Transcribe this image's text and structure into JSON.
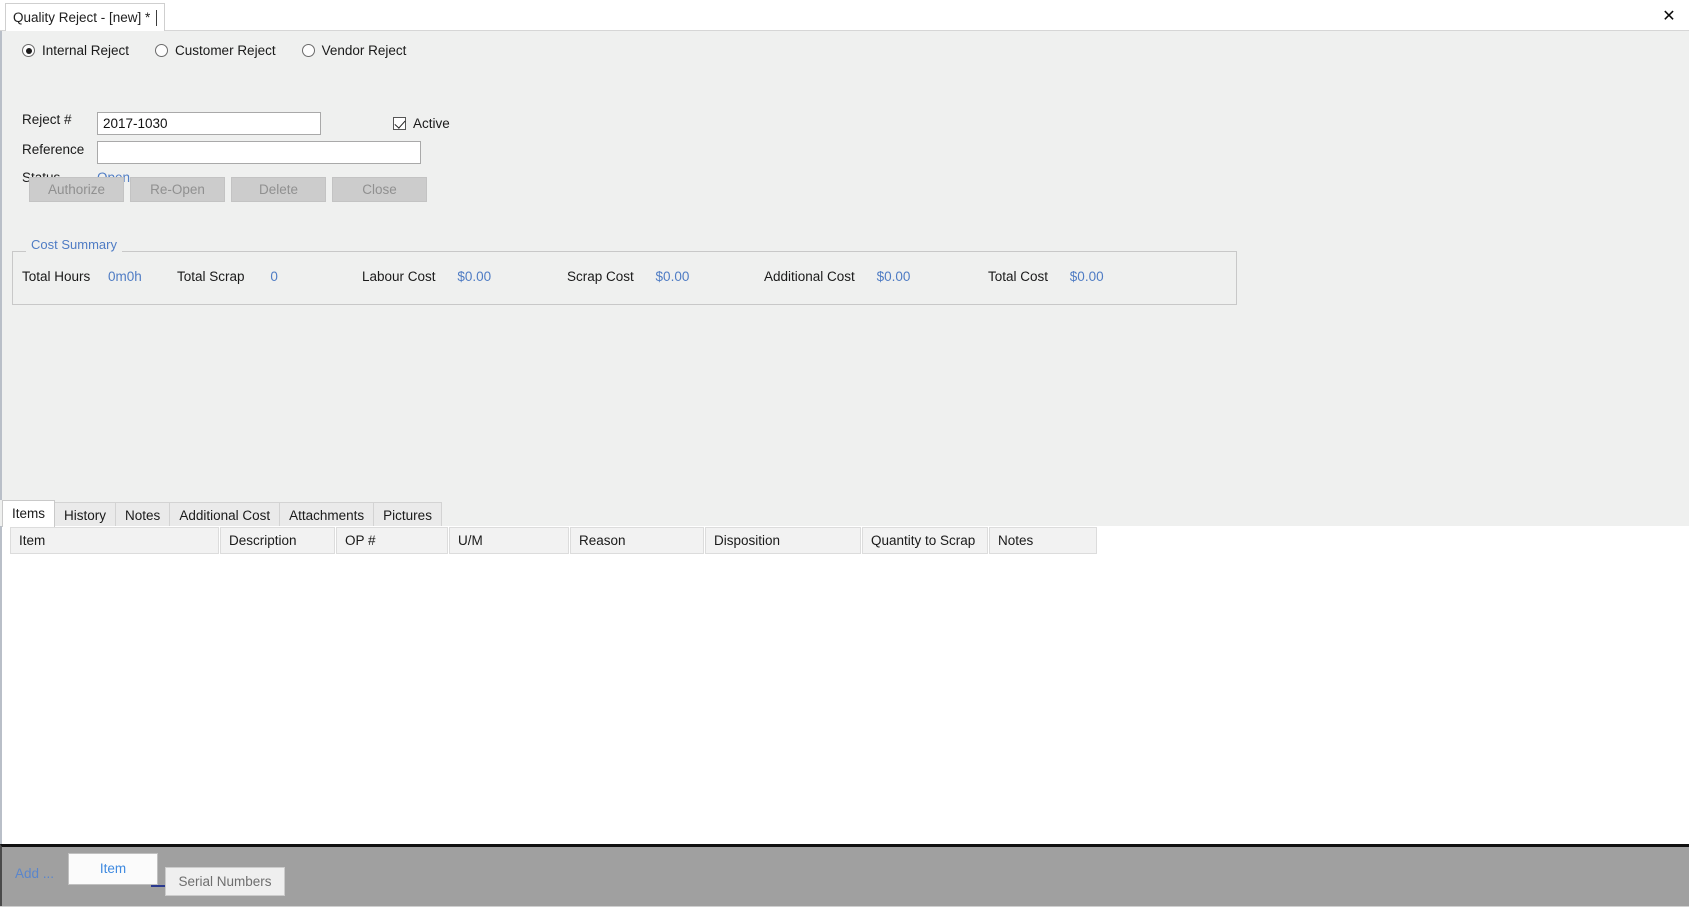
{
  "window": {
    "tab_title": "Quality Reject - [new] *",
    "close_icon": "close-icon"
  },
  "reject_type": {
    "options": [
      {
        "label": "Internal Reject",
        "selected": true
      },
      {
        "label": "Customer Reject",
        "selected": false
      },
      {
        "label": "Vendor Reject",
        "selected": false
      }
    ]
  },
  "form": {
    "reject_number_label": "Reject #",
    "reject_number_value": "2017-1030",
    "reject_number_placeholder": "",
    "active_label": "Active",
    "active_checked": true,
    "reference_label": "Reference",
    "reference_value": "",
    "reference_placeholder": "",
    "status_label": "Status",
    "status_value": "Open"
  },
  "actions": {
    "buttons": [
      {
        "label": "Authorize",
        "enabled": false
      },
      {
        "label": "Re-Open",
        "enabled": false
      },
      {
        "label": "Delete",
        "enabled": false
      },
      {
        "label": "Close",
        "enabled": false
      }
    ]
  },
  "cost_summary": {
    "legend": "Cost Summary",
    "items": [
      {
        "label": "Total Hours",
        "value": "0m0h"
      },
      {
        "label": "Total Scrap",
        "value": "0"
      },
      {
        "label": "Labour Cost",
        "value": "$0.00"
      },
      {
        "label": "Scrap Cost",
        "value": "$0.00"
      },
      {
        "label": "Additional Cost",
        "value": "$0.00"
      },
      {
        "label": "Total Cost",
        "value": "$0.00"
      }
    ]
  },
  "tabs": [
    {
      "label": "Items",
      "active": true
    },
    {
      "label": "History",
      "active": false
    },
    {
      "label": "Notes",
      "active": false
    },
    {
      "label": "Additional Cost",
      "active": false
    },
    {
      "label": "Attachments",
      "active": false
    },
    {
      "label": "Pictures",
      "active": false
    }
  ],
  "grid": {
    "columns": [
      "Item",
      "Description",
      "OP #",
      "U/M",
      "Reason",
      "Disposition",
      "Quantity to Scrap",
      "Notes"
    ],
    "rows": []
  },
  "bottom_bar": {
    "add_label": "Add ...",
    "item_button": "Item",
    "serial_numbers_button": "Serial Numbers"
  },
  "colors": {
    "accent_link": "#4f7cc4",
    "panel_bg": "#eff0ef",
    "toolbar_bg": "#a0a0a0",
    "item_button_text": "#3f8ae0"
  }
}
